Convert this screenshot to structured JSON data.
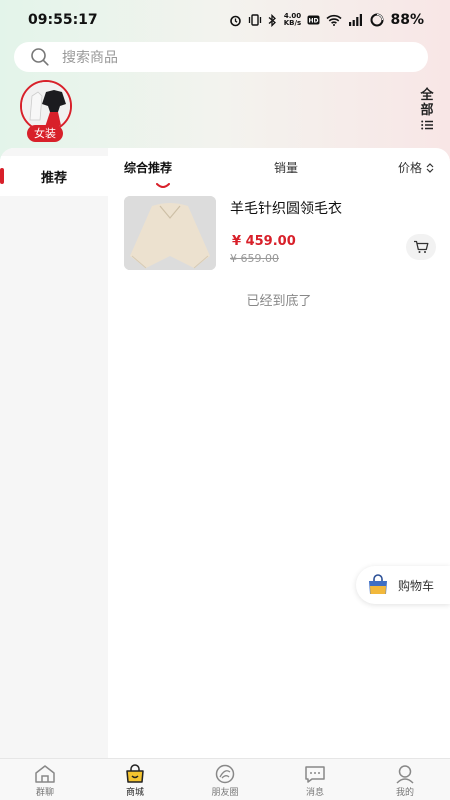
{
  "status_bar": {
    "time": "09:55:17",
    "network_speed": "4.00 KB/s",
    "battery": "88%"
  },
  "search": {
    "placeholder": "搜索商品"
  },
  "category": {
    "label": "女装",
    "all_label": "全部"
  },
  "sidebar": {
    "items": [
      {
        "label": "推荐",
        "active": true
      }
    ]
  },
  "sort_bar": {
    "items": [
      {
        "label": "综合推荐",
        "active": true
      },
      {
        "label": "销量",
        "active": false
      },
      {
        "label": "价格",
        "active": false
      }
    ]
  },
  "products": [
    {
      "title": "羊毛针织圆领毛衣",
      "price": "¥ 459.00",
      "original_price": "¥ 659.00"
    }
  ],
  "list_end_text": "已经到底了",
  "float_cart": {
    "label": "购物车"
  },
  "bottom_nav": {
    "items": [
      {
        "label": "群聊",
        "icon": "home-icon"
      },
      {
        "label": "商城",
        "icon": "shop-bag-icon",
        "active": true
      },
      {
        "label": "朋友圈",
        "icon": "moments-icon"
      },
      {
        "label": "消息",
        "icon": "message-icon"
      },
      {
        "label": "我的",
        "icon": "profile-icon"
      }
    ]
  },
  "colors": {
    "accent": "#d8202a",
    "price": "#d8202a"
  }
}
